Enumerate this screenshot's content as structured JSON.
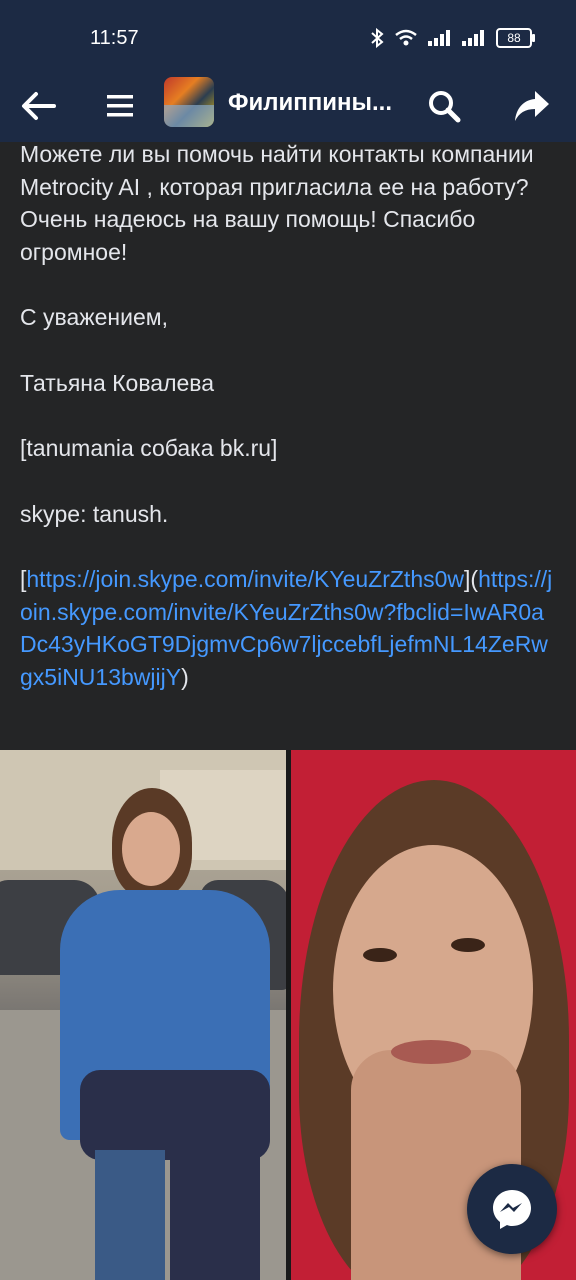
{
  "status_bar": {
    "time": "11:57",
    "battery": "88"
  },
  "app_bar": {
    "title": "Филиппины..."
  },
  "post": {
    "intro": "Можете ли вы помочь найти контакты компании Metrocity AI , которая пригласила ее на работу? Очень надеюсь на вашу помощь! Спасибо огромное!",
    "regards": "С уважением,",
    "name": "Татьяна Ковалева",
    "email": "[tanumania собака bk.ru]",
    "skype": "skype: tanush.",
    "link_open": "[",
    "link_text": "https://join.skype.com/invite/KYeuZrZths0w",
    "link_mid": "](",
    "link_url": "https://join.skype.com/invite/KYeuZrZths0w?fbclid=IwAR0aDc43yHKoGT9DjgmvCp6w7ljccebfLjefmNL14ZeRwgx5iNU13bwjijY",
    "link_close": ")"
  },
  "photos": [
    "photo-left",
    "photo-right"
  ],
  "colors": {
    "bar": "#1c2a44",
    "background": "#242526",
    "link": "#4599ff"
  }
}
